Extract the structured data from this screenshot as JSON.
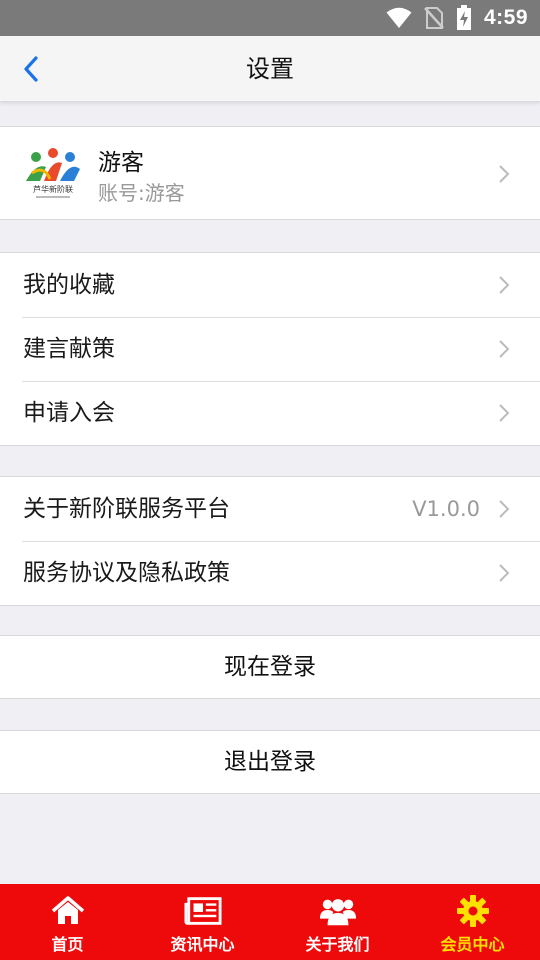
{
  "status_bar": {
    "time": "4:59",
    "icons": [
      "wifi-icon",
      "no-sim-icon",
      "battery-charging-icon"
    ]
  },
  "header": {
    "title": "设置",
    "back_icon": "chevron-left-icon"
  },
  "profile": {
    "name": "游客",
    "account": "账号:游客",
    "avatar_logo_text": "芦华新阶联"
  },
  "menu_group_1": [
    {
      "label": "我的收藏"
    },
    {
      "label": "建言献策"
    },
    {
      "label": "申请入会"
    }
  ],
  "menu_group_2": [
    {
      "label": "关于新阶联服务平台",
      "value": "V1.0.0"
    },
    {
      "label": "服务协议及隐私政策"
    }
  ],
  "buttons": {
    "login": "现在登录",
    "logout": "退出登录"
  },
  "tab_bar": {
    "items": [
      {
        "label": "首页",
        "icon": "home-icon"
      },
      {
        "label": "资讯中心",
        "icon": "newspaper-icon"
      },
      {
        "label": "关于我们",
        "icon": "group-icon"
      },
      {
        "label": "会员中心",
        "icon": "gear-icon",
        "active": true
      }
    ],
    "colors": {
      "background": "#ee0a0a",
      "active": "#ffe100",
      "inactive": "#ffffff"
    }
  },
  "colors": {
    "accent": "#1a73e8",
    "page_background": "#efeff4"
  }
}
